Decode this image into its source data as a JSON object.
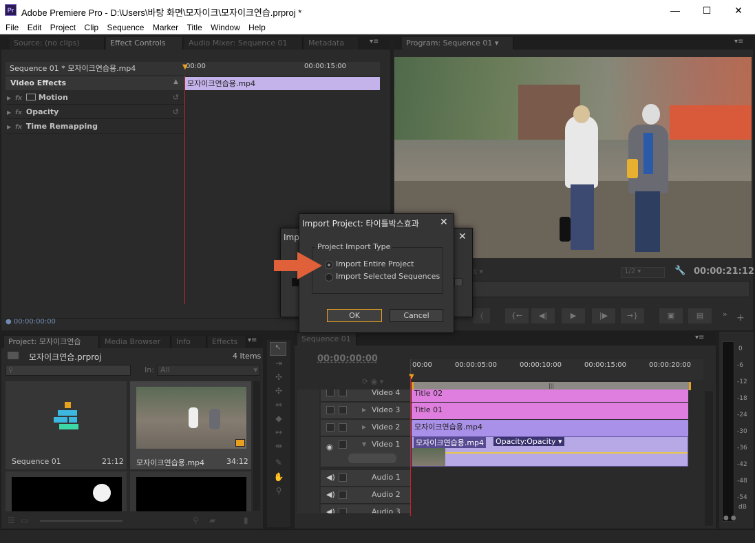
{
  "window": {
    "app_icon": "Pr",
    "title": "Adobe Premiere Pro - D:\\Users\\바탕 화면\\모자이크\\모자이크연습.prproj *",
    "minimize": "—",
    "maximize": "☐",
    "close": "✕"
  },
  "menu": [
    "File",
    "Edit",
    "Project",
    "Clip",
    "Sequence",
    "Marker",
    "Title",
    "Window",
    "Help"
  ],
  "top_left_tabs": [
    "Source: (no clips)",
    "Effect Controls",
    "Audio Mixer: Sequence 01",
    "Metadata"
  ],
  "effect_controls": {
    "sequence_label": "Sequence 01 * 모자이크연습용.mp4",
    "section": "Video Effects",
    "effects": [
      "Motion",
      "Opacity",
      "Time Remapping"
    ],
    "fx_label": "fx",
    "ruler_start": "00:00",
    "ruler_mid": "00:00:15:00",
    "clip_name": "모자이크연습용.mp4",
    "timecode": "00:00:00:00"
  },
  "program": {
    "tab": "Program: Sequence 01",
    "fit": "Fit",
    "resolution": "1/2",
    "timecode": "00:00:21:12",
    "buttons": [
      "{",
      "}",
      "{←",
      "◀|",
      "▶",
      "|▶",
      "→}",
      "▣",
      "▤",
      "»",
      "+"
    ]
  },
  "project": {
    "tabs": [
      "Project: 모자이크연습",
      "Media Browser",
      "Info",
      "Effects"
    ],
    "file": "모자이크연습.prproj",
    "items_count": "4 Items",
    "search_placeholder": "",
    "in_label": "In:",
    "in_value": "All",
    "thumbs": [
      {
        "name": "Sequence 01",
        "duration": "21:12"
      },
      {
        "name": "모자이크연습용.mp4",
        "duration": "34:12"
      }
    ]
  },
  "sequence": {
    "tab": "Sequence 01",
    "timecode": "00:00:00:00",
    "ruler": [
      "00:00",
      "00:00:05:00",
      "00:00:10:00",
      "00:00:15:00",
      "00:00:20:00"
    ],
    "tracks": [
      {
        "name": "Video 4",
        "clip": "Title 02"
      },
      {
        "name": "Video 3",
        "clip": "Title 01"
      },
      {
        "name": "Video 2",
        "clip": "모자이크연습용.mp4"
      },
      {
        "name": "Video 1",
        "clip": "모자이크연습용.mp4",
        "effect": "Opacity:Opacity ▾"
      },
      {
        "name": "Audio 1"
      },
      {
        "name": "Audio 2"
      },
      {
        "name": "Audio 3"
      }
    ]
  },
  "meter": {
    "labels": [
      "0",
      "-6",
      "-12",
      "-18",
      "-24",
      "-30",
      "-36",
      "-42",
      "-48",
      "-54",
      "dB"
    ]
  },
  "behind_dialog": {
    "title": "Impo"
  },
  "dialog": {
    "title": "Import Project: 타이틀박스효과",
    "close": "✕",
    "group": "Project Import Type",
    "options": [
      "Import Entire Project",
      "Import Selected Sequences"
    ],
    "selected": 0,
    "ok": "OK",
    "cancel": "Cancel"
  },
  "colors": {
    "accent_arrow": "#e0603a",
    "title_clip": "#e07ee0",
    "video_clip": "#a990e8",
    "playhead": "#e8a020"
  }
}
